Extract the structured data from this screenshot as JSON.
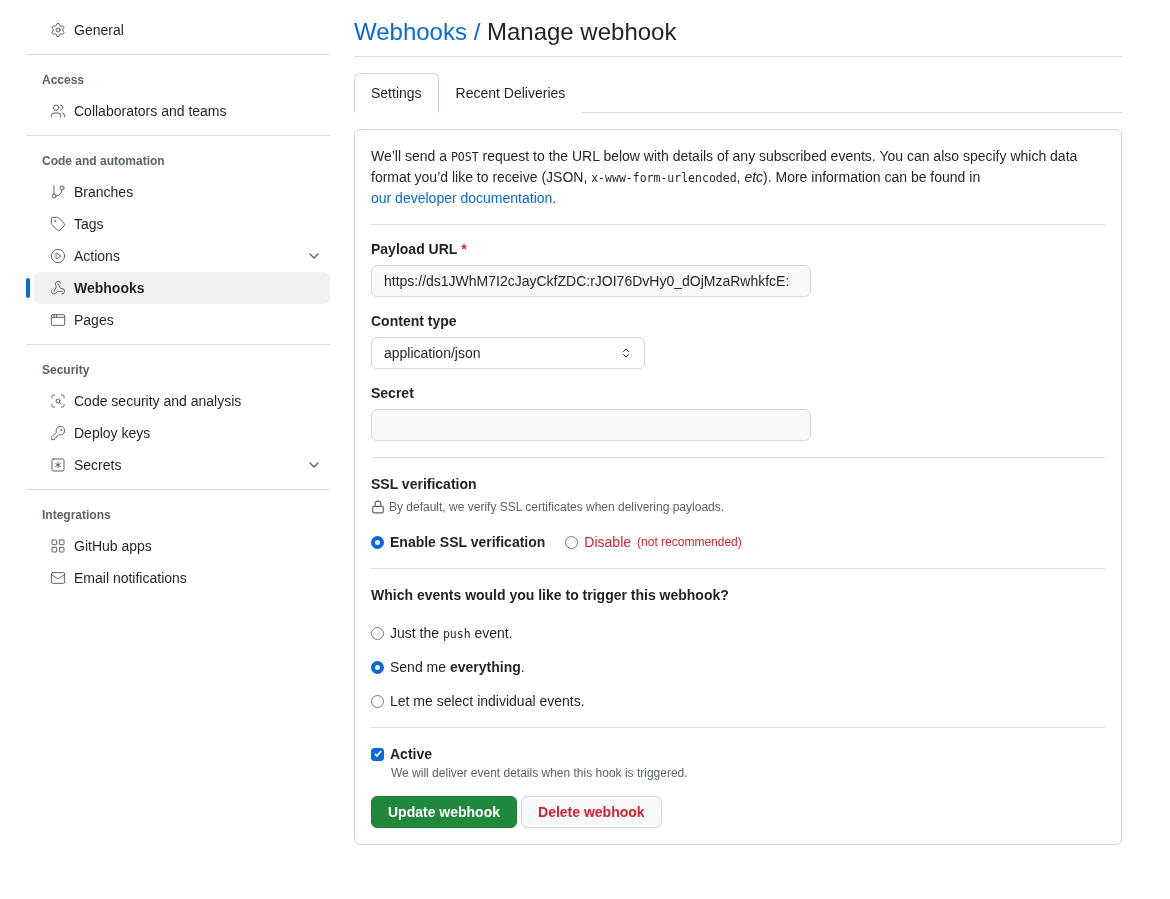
{
  "sidebar": {
    "top_item": {
      "label": "General",
      "selected": false
    },
    "sections": [
      {
        "heading": "Access",
        "items": [
          {
            "label": "Collaborators and teams",
            "selected": false,
            "expandable": false
          }
        ]
      },
      {
        "heading": "Code and automation",
        "items": [
          {
            "label": "Branches",
            "selected": false,
            "expandable": false
          },
          {
            "label": "Tags",
            "selected": false,
            "expandable": false
          },
          {
            "label": "Actions",
            "selected": false,
            "expandable": true
          },
          {
            "label": "Webhooks",
            "selected": true,
            "expandable": false
          },
          {
            "label": "Pages",
            "selected": false,
            "expandable": false
          }
        ]
      },
      {
        "heading": "Security",
        "items": [
          {
            "label": "Code security and analysis",
            "selected": false,
            "expandable": false
          },
          {
            "label": "Deploy keys",
            "selected": false,
            "expandable": false
          },
          {
            "label": "Secrets",
            "selected": false,
            "expandable": true
          }
        ]
      },
      {
        "heading": "Integrations",
        "items": [
          {
            "label": "GitHub apps",
            "selected": false,
            "expandable": false
          },
          {
            "label": "Email notifications",
            "selected": false,
            "expandable": false
          }
        ]
      }
    ]
  },
  "breadcrumb": {
    "parent": "Webhooks /",
    "current": "Manage webhook"
  },
  "tabs": [
    {
      "label": "Settings",
      "selected": true
    },
    {
      "label": "Recent Deliveries",
      "selected": false
    }
  ],
  "intro": [
    {
      "kind": "text",
      "text": "We’ll send a "
    },
    {
      "kind": "code",
      "text": "POST"
    },
    {
      "kind": "text",
      "text": " request to the URL below with details of any subscribed events. You can also specify which data format you’d like to receive (JSON, "
    },
    {
      "kind": "code",
      "text": "x-www-form-urlencoded"
    },
    {
      "kind": "text",
      "text": ", *etc*). More information can be found in "
    },
    {
      "kind": "link",
      "text": "our developer documentation"
    },
    {
      "kind": "text",
      "text": "."
    }
  ],
  "payload_url": {
    "label": "Payload URL",
    "required_mark": "*",
    "value": "https://ds1JWhM7I2cJayCkfZDC:rJOI76DvHy0_dOjMzaRwhkfcE:"
  },
  "content_type": {
    "label": "Content type",
    "value": "application/json"
  },
  "secret": {
    "label": "Secret"
  },
  "ssl": {
    "heading": "SSL verification",
    "note": "By default, we verify SSL certificates when delivering payloads.",
    "options": [
      {
        "label": "Enable SSL verification",
        "kind": "default",
        "selected": true
      },
      {
        "label": "Disable",
        "note": "(not recommended)",
        "kind": "danger",
        "selected": false
      }
    ]
  },
  "events": {
    "question": "Which events would you like to trigger this webhook?",
    "options": [
      {
        "selected": false,
        "parts": [
          {
            "kind": "text",
            "text": "Just the "
          },
          {
            "kind": "code",
            "text": "push"
          },
          {
            "kind": "text",
            "text": " event."
          }
        ]
      },
      {
        "selected": true,
        "parts": [
          {
            "kind": "text",
            "text": "Send me **everything**."
          }
        ]
      },
      {
        "selected": false,
        "parts": [
          {
            "kind": "text",
            "text": "Let me select individual events."
          }
        ]
      }
    ]
  },
  "active": {
    "label": "Active",
    "note": "We will deliver event details when this hook is triggered.",
    "checked": true
  },
  "buttons": [
    {
      "label": "Update webhook",
      "kind": "primary"
    },
    {
      "label": "Delete webhook",
      "kind": "danger"
    }
  ]
}
